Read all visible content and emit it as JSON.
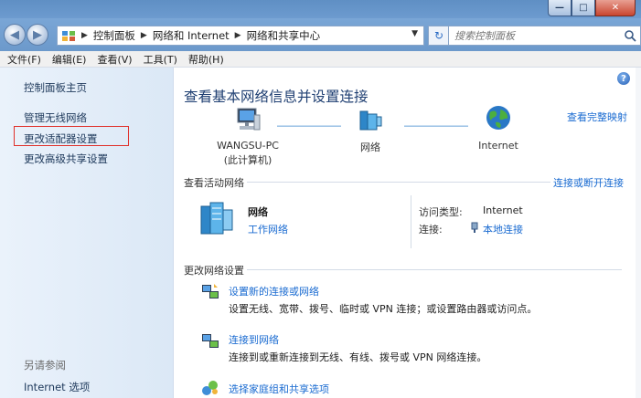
{
  "window": {
    "min_label": "—",
    "max_label": "□",
    "close_label": "✕"
  },
  "address": {
    "crumbs": [
      "控制面板",
      "网络和 Internet",
      "网络和共享中心"
    ],
    "search_placeholder": "搜索控制面板"
  },
  "menu": {
    "items": [
      "文件(F)",
      "编辑(E)",
      "查看(V)",
      "工具(T)",
      "帮助(H)"
    ]
  },
  "sidebar": {
    "home": "控制面板主页",
    "wireless": "管理无线网络",
    "adapter": "更改适配器设置",
    "advanced_share": "更改高级共享设置",
    "see_also": "另请参阅",
    "internet_options": "Internet 选项"
  },
  "main": {
    "title": "查看基本网络信息并设置连接",
    "full_map": "查看完整映射",
    "map": {
      "computer_name": "WANGSU-PC",
      "computer_sub": "(此计算机)",
      "network": "网络",
      "internet": "Internet"
    },
    "active_networks": {
      "title": "查看活动网络",
      "connect_link": "连接或断开连接",
      "network_name": "网络",
      "network_type": "工作网络",
      "access_type_label": "访问类型:",
      "access_type_value": "Internet",
      "connection_label": "连接:",
      "connection_value": "本地连接"
    },
    "change_settings": {
      "title": "更改网络设置",
      "tasks": [
        {
          "title": "设置新的连接或网络",
          "desc": "设置无线、宽带、拨号、临时或 VPN 连接；或设置路由器或访问点。"
        },
        {
          "title": "连接到网络",
          "desc": "连接到或重新连接到无线、有线、拨号或 VPN 网络连接。"
        },
        {
          "title": "选择家庭组和共享选项",
          "desc": ""
        }
      ]
    }
  },
  "colors": {
    "link": "#1a6bd1",
    "title": "#1f3f72",
    "highlight_box": "#e0302a"
  }
}
